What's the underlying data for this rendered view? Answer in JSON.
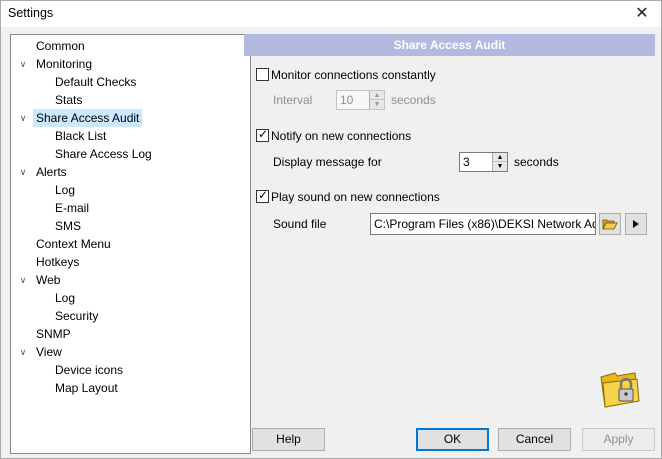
{
  "window": {
    "title": "Settings",
    "close_glyph": "✕"
  },
  "tree": {
    "items": [
      {
        "label": "Common"
      },
      {
        "label": "Monitoring"
      },
      {
        "label": "Default Checks"
      },
      {
        "label": "Stats"
      },
      {
        "label": "Share Access Audit",
        "selected": true
      },
      {
        "label": "Black List"
      },
      {
        "label": "Share Access Log"
      },
      {
        "label": "Alerts"
      },
      {
        "label": "Log"
      },
      {
        "label": "E-mail"
      },
      {
        "label": "SMS"
      },
      {
        "label": "Context Menu"
      },
      {
        "label": "Hotkeys"
      },
      {
        "label": "Web"
      },
      {
        "label": "Log"
      },
      {
        "label": "Security"
      },
      {
        "label": "SNMP"
      },
      {
        "label": "View"
      },
      {
        "label": "Device icons"
      },
      {
        "label": "Map Layout"
      }
    ]
  },
  "panel": {
    "header": "Share Access Audit",
    "monitor": {
      "label": "Monitor connections constantly",
      "checked": false
    },
    "interval": {
      "label": "Interval",
      "value": "10",
      "unit": "seconds"
    },
    "notify": {
      "label": "Notify on new connections",
      "checked": true
    },
    "display_msg": {
      "label": "Display message for",
      "value": "3",
      "unit": "seconds"
    },
    "sound": {
      "label": "Play sound on new connections",
      "checked": true
    },
    "sound_file": {
      "label": "Sound file",
      "value": "C:\\Program Files (x86)\\DEKSI Network Ad"
    },
    "browse_icon": "folder-open-icon",
    "play_icon": "play-icon"
  },
  "buttons": {
    "help": "Help",
    "ok": "OK",
    "cancel": "Cancel",
    "apply": "Apply"
  },
  "colors": {
    "header_bg": "#b4b9e0",
    "selection_bg": "#cce8ff",
    "accent": "#0078d7"
  }
}
